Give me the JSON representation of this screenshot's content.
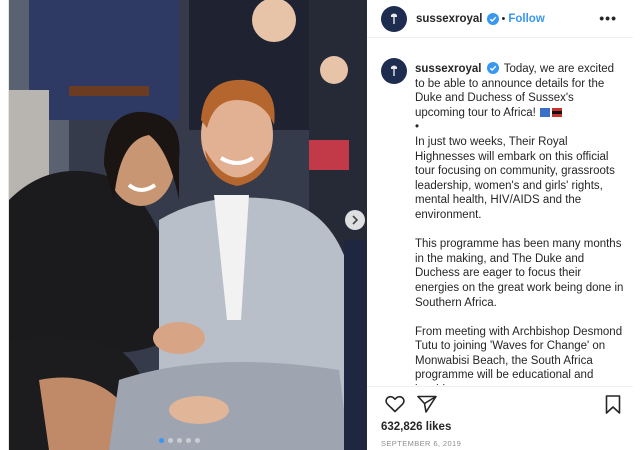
{
  "header": {
    "username": "sussexroyal",
    "separator": "•",
    "follow_label": "Follow",
    "more_label": "•••"
  },
  "caption": {
    "username": "sussexroyal",
    "paragraphs": [
      "Today, we are excited to be able to announce details for the Duke and Duchess of Sussex's upcoming tour to Africa!",
      "•",
      "In just two weeks, Their Royal Highnesses will embark on this official tour focusing on community, grassroots leadership, women's and girls' rights, mental health, HIV/AIDS and the environment.",
      "This programme has been many months in the making, and The Duke and Duchess are eager to focus their energies on the great work being done in Southern Africa.",
      "From meeting with Archbishop Desmond Tutu to joining 'Waves for Change' on Monwabisi Beach, the South Africa programme will be educational and inspiring."
    ]
  },
  "post": {
    "likes": "632,826 likes",
    "date": "SEPTEMBER 6, 2019",
    "carousel_dots": 5,
    "carousel_active": 0
  },
  "icons": {
    "like": "heart-icon",
    "share": "paper-plane-icon",
    "save": "bookmark-icon",
    "verified": "verified-badge-icon",
    "next": "chevron-right-icon"
  },
  "colors": {
    "link_blue": "#3897f0",
    "text": "#262626",
    "muted": "#8e8e8e",
    "avatar_navy": "#1d2c4f"
  }
}
